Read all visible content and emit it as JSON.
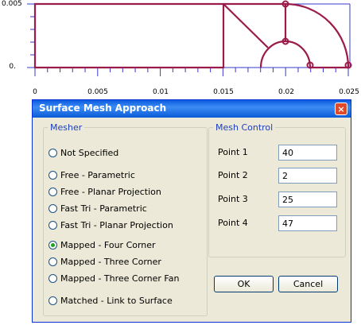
{
  "plot": {
    "y_ticks": [
      "0.005",
      "0."
    ],
    "x_ticks": [
      "0",
      "0.005",
      "0.01",
      "0.015",
      "0.02",
      "0.025"
    ]
  },
  "dialog": {
    "title": "Surface Mesh Approach",
    "close_glyph": "×",
    "mesher": {
      "legend": "Mesher",
      "options": [
        {
          "label": "Not Specified",
          "checked": false
        },
        {
          "label": "Free - Parametric",
          "checked": false
        },
        {
          "label": "Free - Planar Projection",
          "checked": false
        },
        {
          "label": "Fast Tri - Parametric",
          "checked": false
        },
        {
          "label": "Fast Tri - Planar Projection",
          "checked": false
        },
        {
          "label": "Mapped - Four Corner",
          "checked": true
        },
        {
          "label": "Mapped - Three Corner",
          "checked": false
        },
        {
          "label": "Mapped - Three Corner Fan",
          "checked": false
        },
        {
          "label": "Matched - Link to Surface",
          "checked": false
        }
      ]
    },
    "mesh_control": {
      "legend": "Mesh Control",
      "points": [
        {
          "label": "Point 1",
          "value": "40"
        },
        {
          "label": "Point 2",
          "value": "2"
        },
        {
          "label": "Point 3",
          "value": "25"
        },
        {
          "label": "Point 4",
          "value": "47"
        }
      ]
    },
    "ok_label": "OK",
    "cancel_label": "Cancel"
  },
  "colors": {
    "geometry": "#9b1b4b",
    "axis": "#3a3acc",
    "title_bar": "#0a5ae0"
  }
}
